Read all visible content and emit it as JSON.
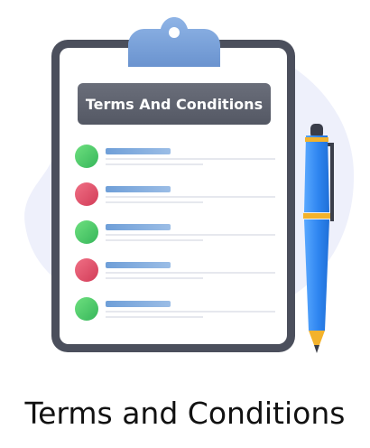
{
  "illustration": {
    "header_label": "Terms And Conditions",
    "checklist_items": [
      {
        "status": "accepted",
        "color": "#4cc96a"
      },
      {
        "status": "rejected",
        "color": "#e05068"
      },
      {
        "status": "accepted",
        "color": "#4cc96a"
      },
      {
        "status": "rejected",
        "color": "#e05068"
      },
      {
        "status": "accepted",
        "color": "#4cc96a"
      }
    ]
  },
  "caption": "Terms and Conditions",
  "colors": {
    "blob": "#eef0fb",
    "board_frame": "#4b4f5c",
    "clip": "#7ea4d8",
    "header_bg": "#5e626e",
    "pen_body": "#3b8cf0",
    "pen_band": "#f3b22c"
  }
}
